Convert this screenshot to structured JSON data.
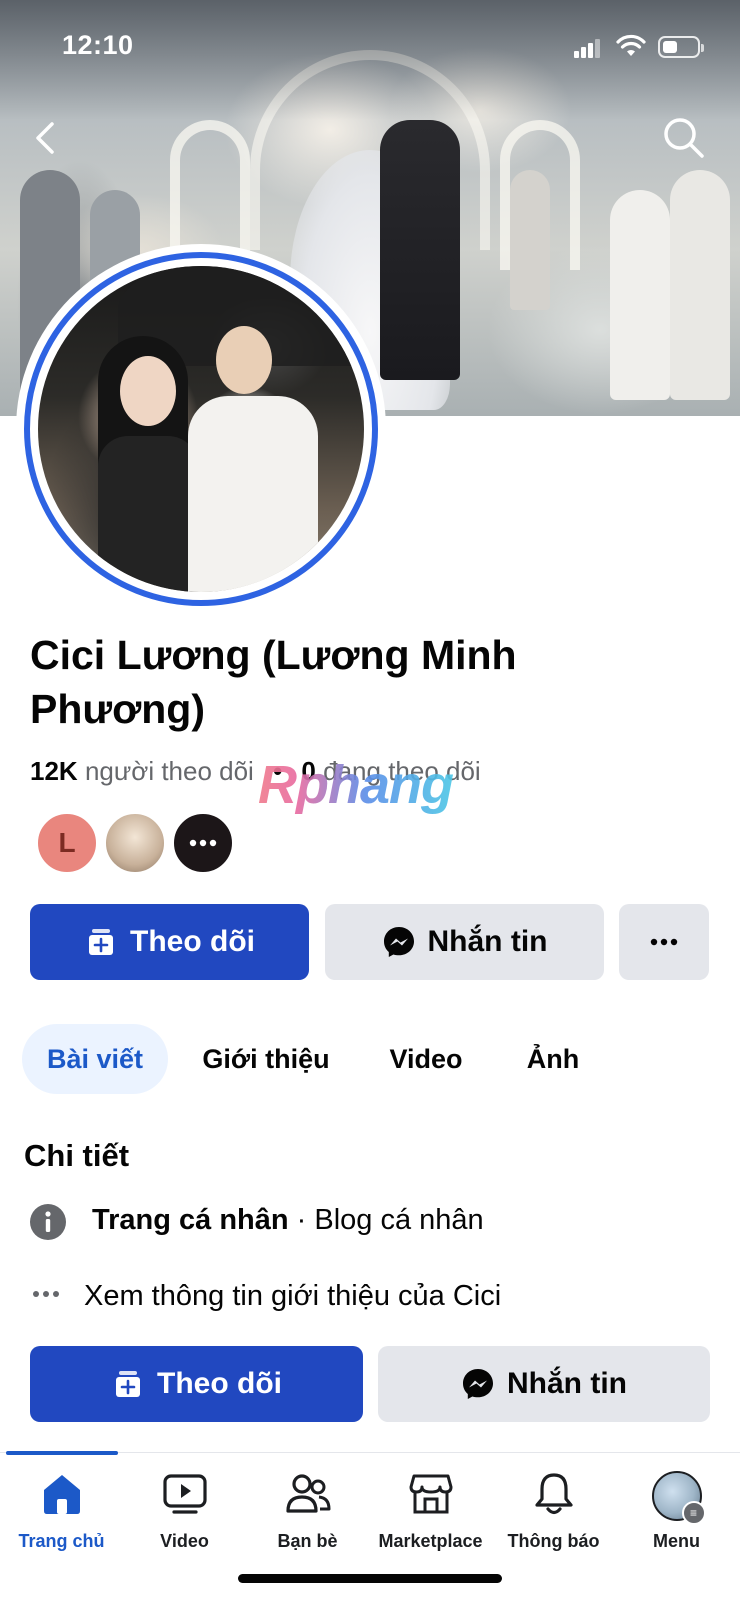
{
  "status_bar": {
    "time": "12:10"
  },
  "profile": {
    "name": "Cici Lương (Lương Minh Phương)",
    "followers_count": "12K",
    "followers_label": "người theo dõi",
    "following_count": "0",
    "following_label": "đang theo dõi",
    "mutual_initial": "L",
    "mutual_more": "•••"
  },
  "watermark": "Rphang",
  "actions": {
    "follow_label": "Theo dõi",
    "message_label": "Nhắn tin",
    "more_label": "•••"
  },
  "tabs": [
    {
      "label": "Bài viết",
      "active": true
    },
    {
      "label": "Giới thiệu",
      "active": false
    },
    {
      "label": "Video",
      "active": false
    },
    {
      "label": "Ảnh",
      "active": false
    }
  ],
  "details": {
    "title": "Chi tiết",
    "page_type_bold": "Trang cá nhân",
    "page_type_rest": " · Blog cá nhân",
    "see_about": "Xem thông tin giới thiệu của Cici"
  },
  "bottom_nav": [
    {
      "label": "Trang chủ",
      "icon": "home-icon",
      "active": true
    },
    {
      "label": "Video",
      "icon": "video-icon",
      "active": false
    },
    {
      "label": "Bạn bè",
      "icon": "friends-icon",
      "active": false
    },
    {
      "label": "Marketplace",
      "icon": "marketplace-icon",
      "active": false
    },
    {
      "label": "Thông báo",
      "icon": "bell-icon",
      "active": false
    },
    {
      "label": "Menu",
      "icon": "menu-avatar",
      "active": false
    }
  ],
  "colors": {
    "primary": "#2148c0",
    "secondary_bg": "#e4e6eb",
    "active_tab_bg": "#ebf3ff",
    "active_blue": "#1c59c8",
    "avatar_ring": "#2e63e2"
  }
}
